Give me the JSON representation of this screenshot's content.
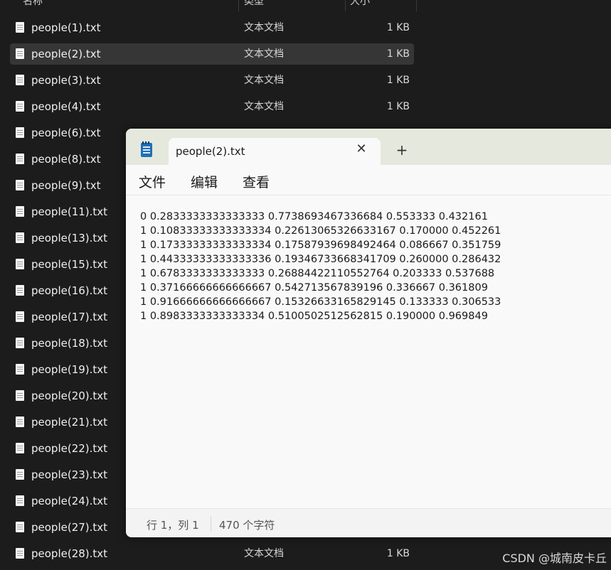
{
  "explorer": {
    "headers": {
      "name": "名称",
      "type": "类型",
      "size": "大小"
    },
    "files": [
      {
        "name": "people(1).txt",
        "type": "文本文档",
        "size": "1 KB"
      },
      {
        "name": "people(2).txt",
        "type": "文本文档",
        "size": "1 KB"
      },
      {
        "name": "people(3).txt",
        "type": "文本文档",
        "size": "1 KB"
      },
      {
        "name": "people(4).txt",
        "type": "文本文档",
        "size": "1 KB"
      },
      {
        "name": "people(6).txt",
        "type": "",
        "size": ""
      },
      {
        "name": "people(8).txt",
        "type": "",
        "size": ""
      },
      {
        "name": "people(9).txt",
        "type": "",
        "size": ""
      },
      {
        "name": "people(11).txt",
        "type": "",
        "size": ""
      },
      {
        "name": "people(13).txt",
        "type": "",
        "size": ""
      },
      {
        "name": "people(15).txt",
        "type": "",
        "size": ""
      },
      {
        "name": "people(16).txt",
        "type": "",
        "size": ""
      },
      {
        "name": "people(17).txt",
        "type": "",
        "size": ""
      },
      {
        "name": "people(18).txt",
        "type": "",
        "size": ""
      },
      {
        "name": "people(19).txt",
        "type": "",
        "size": ""
      },
      {
        "name": "people(20).txt",
        "type": "",
        "size": ""
      },
      {
        "name": "people(21).txt",
        "type": "",
        "size": ""
      },
      {
        "name": "people(22).txt",
        "type": "",
        "size": ""
      },
      {
        "name": "people(23).txt",
        "type": "",
        "size": ""
      },
      {
        "name": "people(24).txt",
        "type": "",
        "size": ""
      },
      {
        "name": "people(27).txt",
        "type": "",
        "size": ""
      },
      {
        "name": "people(28).txt",
        "type": "文本文档",
        "size": "1 KB"
      }
    ],
    "selected_index": 1
  },
  "notepad": {
    "app_icon": "notepad-icon",
    "tab": {
      "title": "people(2).txt",
      "close_glyph": "✕"
    },
    "new_tab_glyph": "+",
    "menu": {
      "file": "文件",
      "edit": "编辑",
      "view": "查看"
    },
    "lines": [
      "0 0.2833333333333333 0.7738693467336684 0.553333 0.432161",
      "1 0.10833333333333334 0.22613065326633167 0.170000 0.452261",
      "1 0.17333333333333334 0.17587939698492464 0.086667 0.351759",
      "1 0.44333333333333336 0.19346733668341709 0.260000 0.286432",
      "1 0.6783333333333333 0.26884422110552764 0.203333 0.537688",
      "1 0.37166666666666667 0.542713567839196 0.336667 0.361809",
      "1 0.91666666666666667 0.15326633165829145 0.133333 0.306533",
      "1 0.8983333333333334 0.5100502512562815 0.190000 0.969849"
    ],
    "status": {
      "position": "行 1，列 1",
      "char_count": "470 个字符"
    }
  },
  "watermark": "CSDN @城南皮卡丘"
}
